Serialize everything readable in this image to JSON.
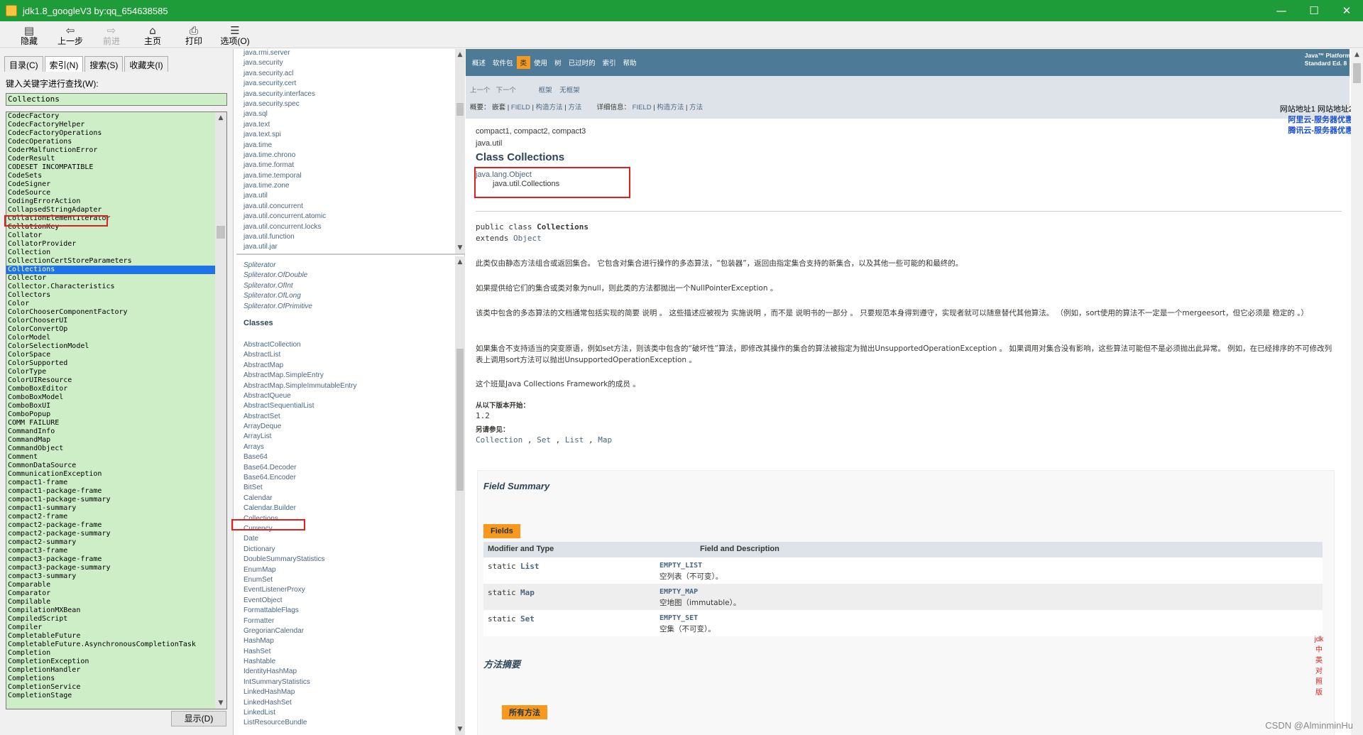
{
  "window": {
    "title": "jdk1.8_googleV3 by:qq_654638585",
    "controls": [
      "—",
      "☐",
      "✕"
    ]
  },
  "toolbar": [
    {
      "icon": "▤",
      "label": "隐藏",
      "enabled": true,
      "icon_name": "hide-icon"
    },
    {
      "icon": "⇦",
      "label": "上一步",
      "enabled": true,
      "icon_name": "back-icon"
    },
    {
      "icon": "⇨",
      "label": "前进",
      "enabled": false,
      "icon_name": "forward-icon"
    },
    {
      "icon": "⌂",
      "label": "主页",
      "enabled": true,
      "icon_name": "home-icon"
    },
    {
      "icon": "⎙",
      "label": "打印",
      "enabled": true,
      "icon_name": "print-icon"
    },
    {
      "icon": "☰",
      "label": "选项(O)",
      "enabled": true,
      "icon_name": "options-icon"
    }
  ],
  "left": {
    "tabs": [
      "目录(C)",
      "索引(N)",
      "搜索(S)",
      "收藏夹(I)"
    ],
    "active_tab": 1,
    "keyword_label": "键入关键字进行查找(W):",
    "keyword_value": "Collections",
    "selected_index": 18,
    "items": [
      "CodecFactory",
      "CodecFactoryHelper",
      "CodecFactoryOperations",
      "CodecOperations",
      "CoderMalfunctionError",
      "CoderResult",
      "CODESET INCOMPATIBLE",
      "CodeSets",
      "CodeSigner",
      "CodeSource",
      "CodingErrorAction",
      "CollapsedStringAdapter",
      "CollationElementIterator",
      "CollationKey",
      "Collator",
      "CollatorProvider",
      "Collection",
      "CollectionCertStoreParameters",
      "Collections",
      "Collector",
      "Collector.Characteristics",
      "Collectors",
      "Color",
      "ColorChooserComponentFactory",
      "ColorChooserUI",
      "ColorConvertOp",
      "ColorModel",
      "ColorSelectionModel",
      "ColorSpace",
      "ColorSupported",
      "ColorType",
      "ColorUIResource",
      "ComboBoxEditor",
      "ComboBoxModel",
      "ComboBoxUI",
      "ComboPopup",
      "COMM FAILURE",
      "CommandInfo",
      "CommandMap",
      "CommandObject",
      "Comment",
      "CommonDataSource",
      "CommunicationException",
      "compact1-frame",
      "compact1-package-frame",
      "compact1-package-summary",
      "compact1-summary",
      "compact2-frame",
      "compact2-package-frame",
      "compact2-package-summary",
      "compact2-summary",
      "compact3-frame",
      "compact3-package-frame",
      "compact3-package-summary",
      "compact3-summary",
      "Comparable",
      "Comparator",
      "Compilable",
      "CompilationMXBean",
      "CompiledScript",
      "Compiler",
      "CompletableFuture",
      "CompletableFuture.AsynchronousCompletionTask",
      "Completion",
      "CompletionException",
      "CompletionHandler",
      "Completions",
      "CompletionService",
      "CompletionStage"
    ],
    "display_button": "显示(D)"
  },
  "packages": [
    "java.rmi.server",
    "java.security",
    "java.security.acl",
    "java.security.cert",
    "java.security.interfaces",
    "java.security.spec",
    "java.sql",
    "java.text",
    "java.text.spi",
    "java.time",
    "java.time.chrono",
    "java.time.format",
    "java.time.temporal",
    "java.time.zone",
    "java.util",
    "java.util.concurrent",
    "java.util.concurrent.atomic",
    "java.util.concurrent.locks",
    "java.util.function",
    "java.util.jar"
  ],
  "class_frame": {
    "interfaces_tail": [
      "Spliterator",
      "Spliterator.OfDouble",
      "Spliterator.OfInt",
      "Spliterator.OfLong",
      "Spliterator.OfPrimitive"
    ],
    "classes_heading": "Classes",
    "selected_class_index": 17,
    "classes": [
      "AbstractCollection",
      "AbstractList",
      "AbstractMap",
      "AbstractMap.SimpleEntry",
      "AbstractMap.SimpleImmutableEntry",
      "AbstractQueue",
      "AbstractSequentialList",
      "AbstractSet",
      "ArrayDeque",
      "ArrayList",
      "Arrays",
      "Base64",
      "Base64.Decoder",
      "Base64.Encoder",
      "BitSet",
      "Calendar",
      "Calendar.Builder",
      "Collections",
      "Currency",
      "Date",
      "Dictionary",
      "DoubleSummaryStatistics",
      "EnumMap",
      "EnumSet",
      "EventListenerProxy",
      "EventObject",
      "FormattableFlags",
      "Formatter",
      "GregorianCalendar",
      "HashMap",
      "HashSet",
      "Hashtable",
      "IdentityHashMap",
      "IntSummaryStatistics",
      "LinkedHashMap",
      "LinkedHashSet",
      "LinkedList",
      "ListResourceBundle"
    ]
  },
  "doc": {
    "nav": [
      "概述",
      "软件包",
      "类",
      "使用",
      "树",
      "已过时的",
      "索引",
      "帮助"
    ],
    "nav_active": 2,
    "platform": [
      "Java™ Platform",
      "Standard Ed. 8"
    ],
    "subnav1": {
      "prev": "上一个",
      "next": "下一个",
      "frames": "框架",
      "noframes": "无框架"
    },
    "subnav2": {
      "summary_label": "概要：",
      "summary_nested": "嵌套",
      "summary_field": "FIELD",
      "summary_ctor": "构造方法",
      "summary_method": "方法",
      "detail_label": "详细信息：",
      "detail_field": "FIELD",
      "detail_ctor": "构造方法",
      "detail_method": "方法"
    },
    "compact_profiles": "compact1, compact2, compact3",
    "package": "java.util",
    "class_title": "Class Collections",
    "inherit_parent": "java.lang.Object",
    "inherit_child": "java.util.Collections",
    "decl_line1_pre": "public class ",
    "decl_line1_name": "Collections",
    "decl_line2_pre": "extends ",
    "decl_line2_link": "Object",
    "paragraphs": [
      "此类仅由静态方法组合或返回集合。 它包含对集合进行操作的多态算法，“包装器”，返回由指定集合支持的新集合，以及其他一些可能的和最终的。",
      "如果提供给它们的集合或类对象为null，则此类的方法都抛出一个NullPointerException 。",
      "该类中包含的多态算法的文档通常包括实现的简要 说明 。 这些描述应被视为 实施说明 ，而不是 说明书的一部分 。 只要规范本身得到遵守，实现者就可以随意替代其他算法。 （例如，sort使用的算法不一定是一个mergeesort，但它必须是 稳定的 。）",
      "如果集合不支持适当的突变原语，例如set方法，则该类中包含的“破坏性”算法，即修改其操作的集合的算法被指定为抛出UnsupportedOperationException 。 如果调用对集合没有影响，这些算法可能但不是必须抛出此异常。 例如，在已经排序的不可修改列表上调用sort方法可以抛出UnsupportedOperationException 。",
      "这个班是Java Collections Framework的成员 。"
    ],
    "since_label": "从以下版本开始：",
    "since_value": "1.2",
    "see_label": "另请参见：",
    "see_links": [
      "Collection",
      "Set",
      "List",
      "Map"
    ],
    "field_summary_title": "Field Summary",
    "fields_tab": "Fields",
    "col1": "Modifier and Type",
    "col2": "Field and Description",
    "fields": [
      {
        "mod": "static",
        "type": "List",
        "name": "EMPTY_LIST",
        "desc": "空列表（不可变）。"
      },
      {
        "mod": "static",
        "type": "Map",
        "name": "EMPTY_MAP",
        "desc": "空地图（immutable）。"
      },
      {
        "mod": "static",
        "type": "Set",
        "name": "EMPTY_SET",
        "desc": "空集（不可变）。"
      }
    ],
    "method_summary_title": "方法摘要",
    "all_methods_tab": "所有方法"
  },
  "side_links": {
    "line1": "网站地址1 网站地址2",
    "link1": "阿里云-服务器优惠",
    "link2": "腾讯云-服务器优惠"
  },
  "vertical_label": [
    "jdk",
    "中",
    "英",
    "对",
    "照",
    "版"
  ],
  "watermark": "CSDN @AlminminHu",
  "colors": {
    "titlebar": "#1e9c3a",
    "index_bg": "#cdeec7",
    "selection": "#1e73e8",
    "nav": "#4d7a97",
    "accent": "#f8981d",
    "highlight_box": "#e0201c"
  }
}
